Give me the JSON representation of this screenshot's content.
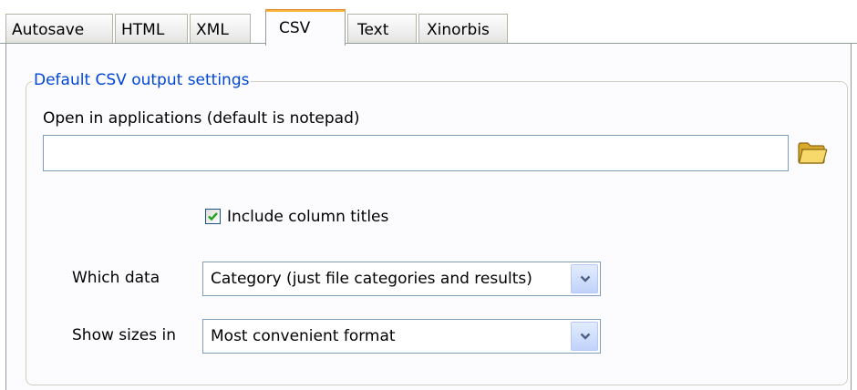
{
  "tabs": [
    {
      "label": "Autosave",
      "active": false
    },
    {
      "label": "HTML",
      "active": false
    },
    {
      "label": "XML",
      "active": false
    },
    {
      "label": "CSV",
      "active": true
    },
    {
      "label": "Text",
      "active": false
    },
    {
      "label": "Xinorbis",
      "active": false
    }
  ],
  "group": {
    "title": "Default CSV output settings"
  },
  "open_in": {
    "label": "Open in applications (default is notepad)",
    "value": "",
    "browse_icon": "folder-icon"
  },
  "include_titles": {
    "label": "Include column titles",
    "checked": true
  },
  "which_data": {
    "label": "Which data",
    "selected": "Category (just file categories and results)"
  },
  "show_sizes": {
    "label": "Show sizes in",
    "selected": "Most convenient format"
  },
  "colors": {
    "accent_tab": "#f8b43a",
    "group_title": "#0046d5",
    "field_border": "#7f9db9"
  }
}
